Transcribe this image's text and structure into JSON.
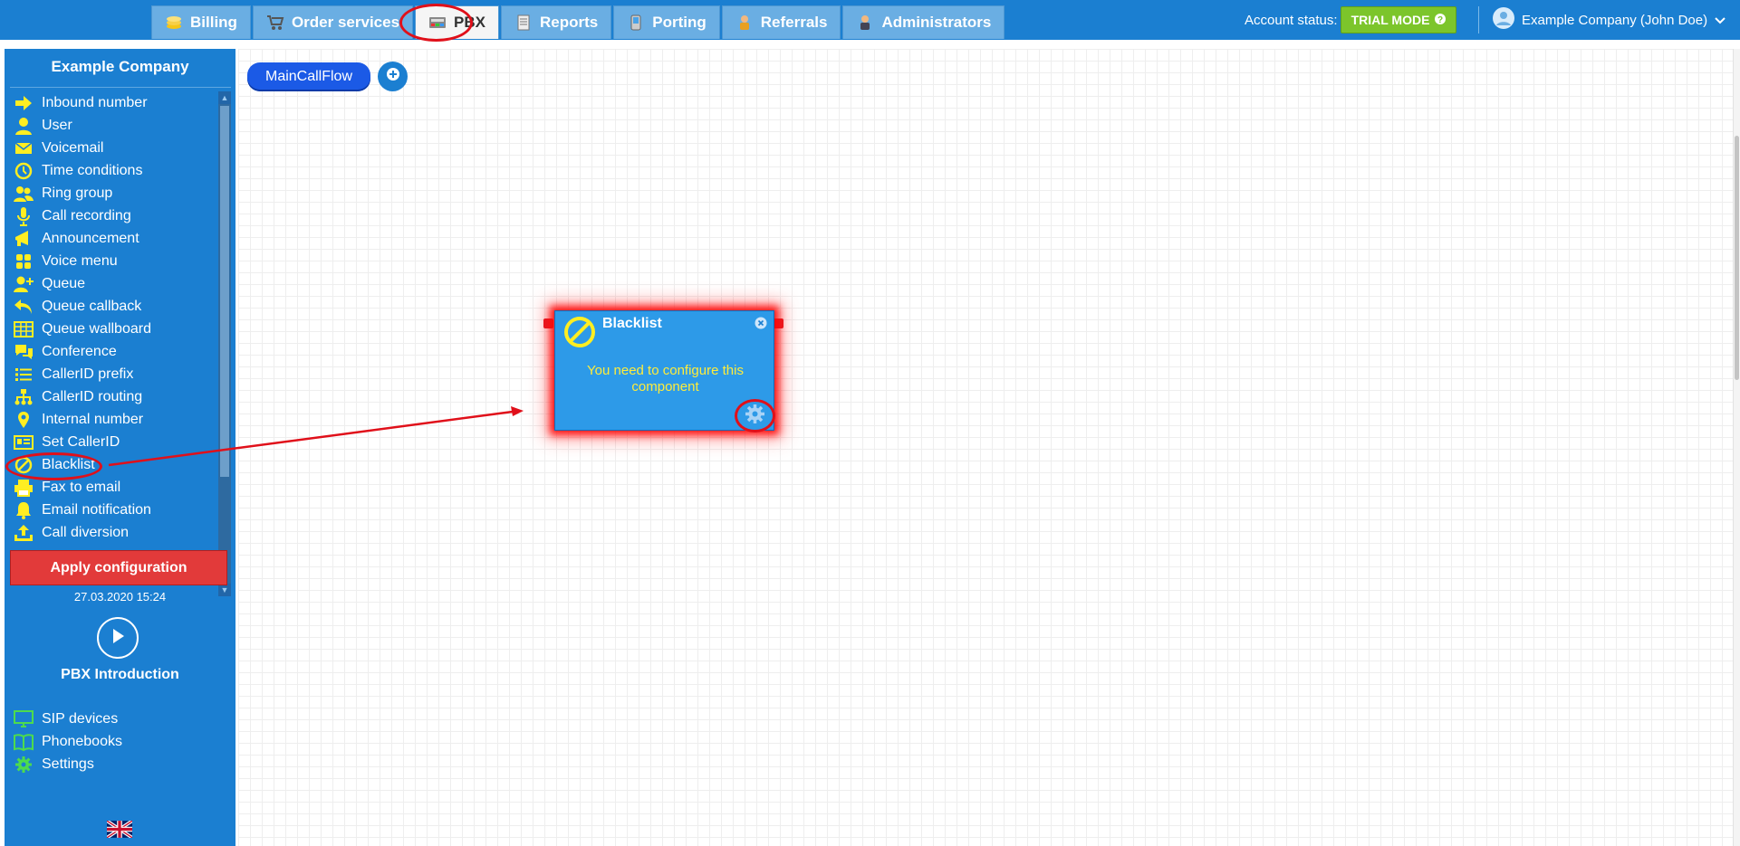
{
  "topnav": {
    "tabs": [
      {
        "label": "Billing",
        "icon": "coins-icon"
      },
      {
        "label": "Order services",
        "icon": "cart-icon"
      },
      {
        "label": "PBX",
        "icon": "pbx-icon",
        "active": true
      },
      {
        "label": "Reports",
        "icon": "report-icon"
      },
      {
        "label": "Porting",
        "icon": "phone-icon"
      },
      {
        "label": "Referrals",
        "icon": "referral-icon"
      },
      {
        "label": "Administrators",
        "icon": "admin-icon"
      }
    ],
    "account_status_label": "Account status:",
    "trial_badge": "TRIAL MODE",
    "user_name": "Example Company (John Doe)"
  },
  "sidebar": {
    "company": "Example Company",
    "items": [
      {
        "label": "Inbound number",
        "icon": "arrow-right-icon"
      },
      {
        "label": "User",
        "icon": "user-icon"
      },
      {
        "label": "Voicemail",
        "icon": "envelope-icon"
      },
      {
        "label": "Time conditions",
        "icon": "clock-icon"
      },
      {
        "label": "Ring group",
        "icon": "users-icon"
      },
      {
        "label": "Call recording",
        "icon": "microphone-icon"
      },
      {
        "label": "Announcement",
        "icon": "megaphone-icon"
      },
      {
        "label": "Voice menu",
        "icon": "grid-icon"
      },
      {
        "label": "Queue",
        "icon": "user-plus-icon"
      },
      {
        "label": "Queue callback",
        "icon": "reply-icon"
      },
      {
        "label": "Queue wallboard",
        "icon": "table-icon"
      },
      {
        "label": "Conference",
        "icon": "comments-icon"
      },
      {
        "label": "CallerID prefix",
        "icon": "list-icon"
      },
      {
        "label": "CallerID routing",
        "icon": "sitemap-icon"
      },
      {
        "label": "Internal number",
        "icon": "map-pin-icon"
      },
      {
        "label": "Set CallerID",
        "icon": "id-card-icon"
      },
      {
        "label": "Blacklist",
        "icon": "ban-icon"
      },
      {
        "label": "Fax to email",
        "icon": "printer-icon"
      },
      {
        "label": "Email notification",
        "icon": "bell-icon"
      },
      {
        "label": "Call diversion",
        "icon": "upload-icon"
      }
    ],
    "apply_label": "Apply configuration",
    "last_applied": "27.03.2020 15:24",
    "intro_label": "PBX Introduction",
    "extras": [
      {
        "label": "SIP devices",
        "icon": "monitor-icon"
      },
      {
        "label": "Phonebooks",
        "icon": "book-icon"
      },
      {
        "label": "Settings",
        "icon": "gear-icon"
      }
    ]
  },
  "canvas": {
    "flow_tab": "MainCallFlow",
    "node": {
      "title": "Blacklist",
      "message": "You need to configure this component"
    }
  },
  "colors": {
    "brand_blue": "#1b7fd1",
    "trial_green": "#7cc52b",
    "apply_red": "#e23a3a",
    "icon_yellow": "#ffee22",
    "icon_green": "#4ddb4d",
    "annotation_red": "#e0101a"
  }
}
